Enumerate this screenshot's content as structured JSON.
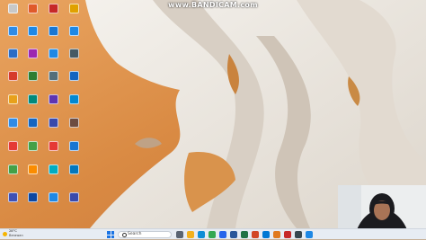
{
  "watermark": "www.BANDICAM.com",
  "desktop_icons": [
    {
      "name": "icon-col1-row1",
      "color": "#c8c8c8"
    },
    {
      "name": "icon-col1-row2",
      "color": "#2f8be6"
    },
    {
      "name": "icon-col1-row3",
      "color": "#2b6cc4"
    },
    {
      "name": "icon-col1-row4",
      "color": "#d63a2b"
    },
    {
      "name": "icon-col1-row5",
      "color": "#e8a11b"
    },
    {
      "name": "icon-col1-row6",
      "color": "#2f8be6"
    },
    {
      "name": "icon-col1-row7",
      "color": "#e53935"
    },
    {
      "name": "icon-col1-row8",
      "color": "#43a047"
    },
    {
      "name": "icon-col1-row9",
      "color": "#3f51b5"
    },
    {
      "name": "icon-col2-row1",
      "color": "#e05a2a"
    },
    {
      "name": "icon-col2-row2",
      "color": "#1e88e5"
    },
    {
      "name": "icon-col2-row3",
      "color": "#9c27b0"
    },
    {
      "name": "icon-col2-row4",
      "color": "#2e7d32"
    },
    {
      "name": "icon-col2-row5",
      "color": "#00897b"
    },
    {
      "name": "icon-col2-row6",
      "color": "#1565c0"
    },
    {
      "name": "icon-col2-row7",
      "color": "#43a047"
    },
    {
      "name": "icon-col2-row8",
      "color": "#fb8c00"
    },
    {
      "name": "icon-col2-row9",
      "color": "#0d47a1"
    },
    {
      "name": "icon-col3-row1",
      "color": "#c62828"
    },
    {
      "name": "icon-col3-row2",
      "color": "#1976d2"
    },
    {
      "name": "icon-col3-row3",
      "color": "#1e88e5"
    },
    {
      "name": "icon-col3-row4",
      "color": "#546e7a"
    },
    {
      "name": "icon-col3-row5",
      "color": "#5e35b1"
    },
    {
      "name": "icon-col3-row6",
      "color": "#3949ab"
    },
    {
      "name": "icon-col3-row7",
      "color": "#e53935"
    },
    {
      "name": "icon-col3-row8",
      "color": "#00acc1"
    },
    {
      "name": "icon-col3-row9",
      "color": "#1e88e5"
    },
    {
      "name": "icon-col4-row1",
      "color": "#e0a100"
    },
    {
      "name": "icon-col4-row2",
      "color": "#1e88e5"
    },
    {
      "name": "icon-col4-row3",
      "color": "#455a64"
    },
    {
      "name": "icon-col4-row4",
      "color": "#1565c0"
    },
    {
      "name": "icon-col4-row5",
      "color": "#0288d1"
    },
    {
      "name": "icon-col4-row6",
      "color": "#6d4c41"
    },
    {
      "name": "icon-col4-row7",
      "color": "#1976d2"
    },
    {
      "name": "icon-col4-row8",
      "color": "#0277bd"
    },
    {
      "name": "icon-col4-row9",
      "color": "#3949ab"
    }
  ],
  "taskbar": {
    "temperature": "28°C",
    "condition": "Berawan",
    "search_placeholder": "Search",
    "apps": [
      {
        "name": "task-view",
        "color": "#5a6472"
      },
      {
        "name": "file-explorer",
        "color": "#f2b01e"
      },
      {
        "name": "edge-browser",
        "color": "#0f8dd6"
      },
      {
        "name": "chrome-browser",
        "color": "#34a853"
      },
      {
        "name": "store",
        "color": "#2563eb"
      },
      {
        "name": "word",
        "color": "#2b579a"
      },
      {
        "name": "excel",
        "color": "#217346"
      },
      {
        "name": "powerpoint",
        "color": "#d24726"
      },
      {
        "name": "vscode",
        "color": "#0078d4"
      },
      {
        "name": "app-orange",
        "color": "#e07a1f"
      },
      {
        "name": "app-red",
        "color": "#c62828"
      },
      {
        "name": "app-dark",
        "color": "#37474f"
      },
      {
        "name": "app-blue",
        "color": "#1e88e5"
      }
    ]
  }
}
